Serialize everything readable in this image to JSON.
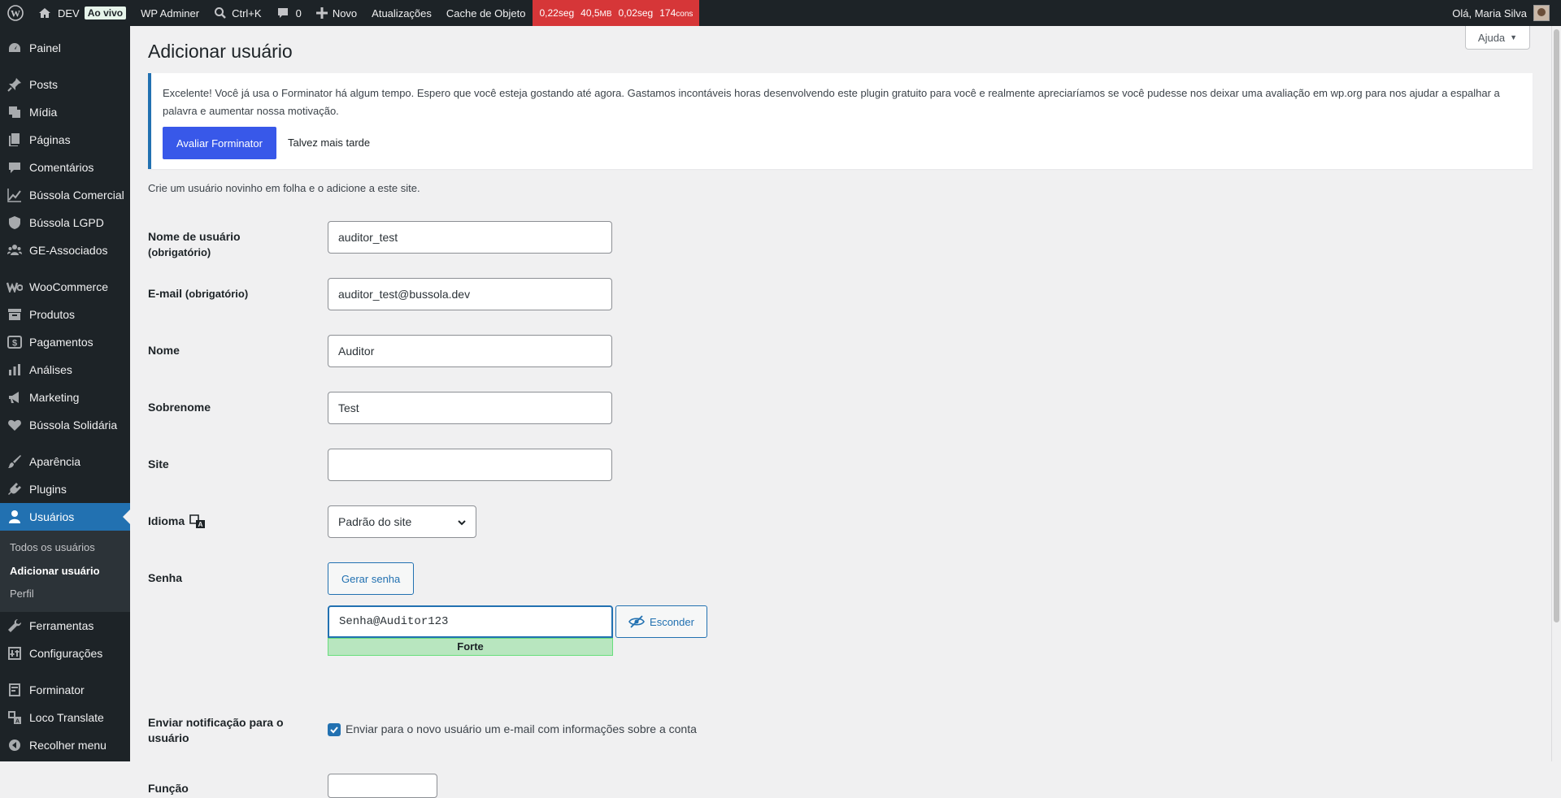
{
  "adminbar": {
    "site_name": "DEV",
    "live_badge": "Ao vivo",
    "wp_adminer": "WP Adminer",
    "search_shortcut": "Ctrl+K",
    "comments_count": "0",
    "new_label": "Novo",
    "updates_label": "Atualizações",
    "cache_label": "Cache de Objeto",
    "qm": {
      "time": "0,22seg",
      "memory": "40,5",
      "memory_unit": "MB",
      "db_time": "0,02seg",
      "queries": "174",
      "queries_unit": "cons"
    },
    "greeting": "Olá, Maria Silva"
  },
  "sidebar": {
    "items": [
      {
        "label": "Painel",
        "icon": "dashboard-icon"
      },
      {
        "label": "Posts",
        "icon": "pin-icon"
      },
      {
        "label": "Mídia",
        "icon": "media-icon"
      },
      {
        "label": "Páginas",
        "icon": "pages-icon"
      },
      {
        "label": "Comentários",
        "icon": "comment-icon"
      },
      {
        "label": "Bússola Comercial",
        "icon": "chart-line-icon"
      },
      {
        "label": "Bússola LGPD",
        "icon": "shield-icon"
      },
      {
        "label": "GE-Associados",
        "icon": "groups-icon"
      },
      {
        "label": "WooCommerce",
        "icon": "woo-icon"
      },
      {
        "label": "Produtos",
        "icon": "archive-icon"
      },
      {
        "label": "Pagamentos",
        "icon": "money-icon"
      },
      {
        "label": "Análises",
        "icon": "bar-chart-icon"
      },
      {
        "label": "Marketing",
        "icon": "megaphone-icon"
      },
      {
        "label": "Bússola Solidária",
        "icon": "heart-icon"
      },
      {
        "label": "Aparência",
        "icon": "brush-icon"
      },
      {
        "label": "Plugins",
        "icon": "plug-icon"
      },
      {
        "label": "Usuários",
        "icon": "user-icon"
      },
      {
        "label": "Ferramentas",
        "icon": "wrench-icon"
      },
      {
        "label": "Configurações",
        "icon": "settings-icon"
      },
      {
        "label": "Forminator",
        "icon": "form-icon"
      },
      {
        "label": "Loco Translate",
        "icon": "translate-icon"
      },
      {
        "label": "Recolher menu",
        "icon": "collapse-icon"
      }
    ],
    "submenu": [
      "Todos os usuários",
      "Adicionar usuário",
      "Perfil"
    ]
  },
  "page": {
    "title": "Adicionar usuário",
    "help": "Ajuda",
    "notice_text": "Excelente! Você já usa o Forminator há algum tempo. Espero que você esteja gostando até agora. Gastamos incontáveis horas desenvolvendo este plugin gratuito para você e realmente apreciaríamos se você pudesse nos deixar uma avaliação em wp.org para nos ajudar a espalhar a palavra e aumentar nossa motivação.",
    "notice_rate": "Avaliar Forminator",
    "notice_later": "Talvez mais tarde",
    "intro": "Crie um usuário novinho em folha e o adicione a este site."
  },
  "form": {
    "username_label": "Nome de usuário",
    "required": "(obrigatório)",
    "username_value": "auditor_test",
    "email_label": "E-mail",
    "email_value": "auditor_test@bussola.dev",
    "first_name_label": "Nome",
    "first_name_value": "Auditor",
    "last_name_label": "Sobrenome",
    "last_name_value": "Test",
    "site_label": "Site",
    "site_value": "",
    "language_label": "Idioma",
    "language_value": "Padrão do site",
    "password_label": "Senha",
    "generate_password": "Gerar senha",
    "password_value": "Senha@Auditor123",
    "hide_password": "Esconder",
    "strength": "Forte",
    "notify_label": "Enviar notificação para o usuário",
    "notify_text": "Enviar para o novo usuário um e-mail com informações sobre a conta",
    "role_label": "Função"
  }
}
